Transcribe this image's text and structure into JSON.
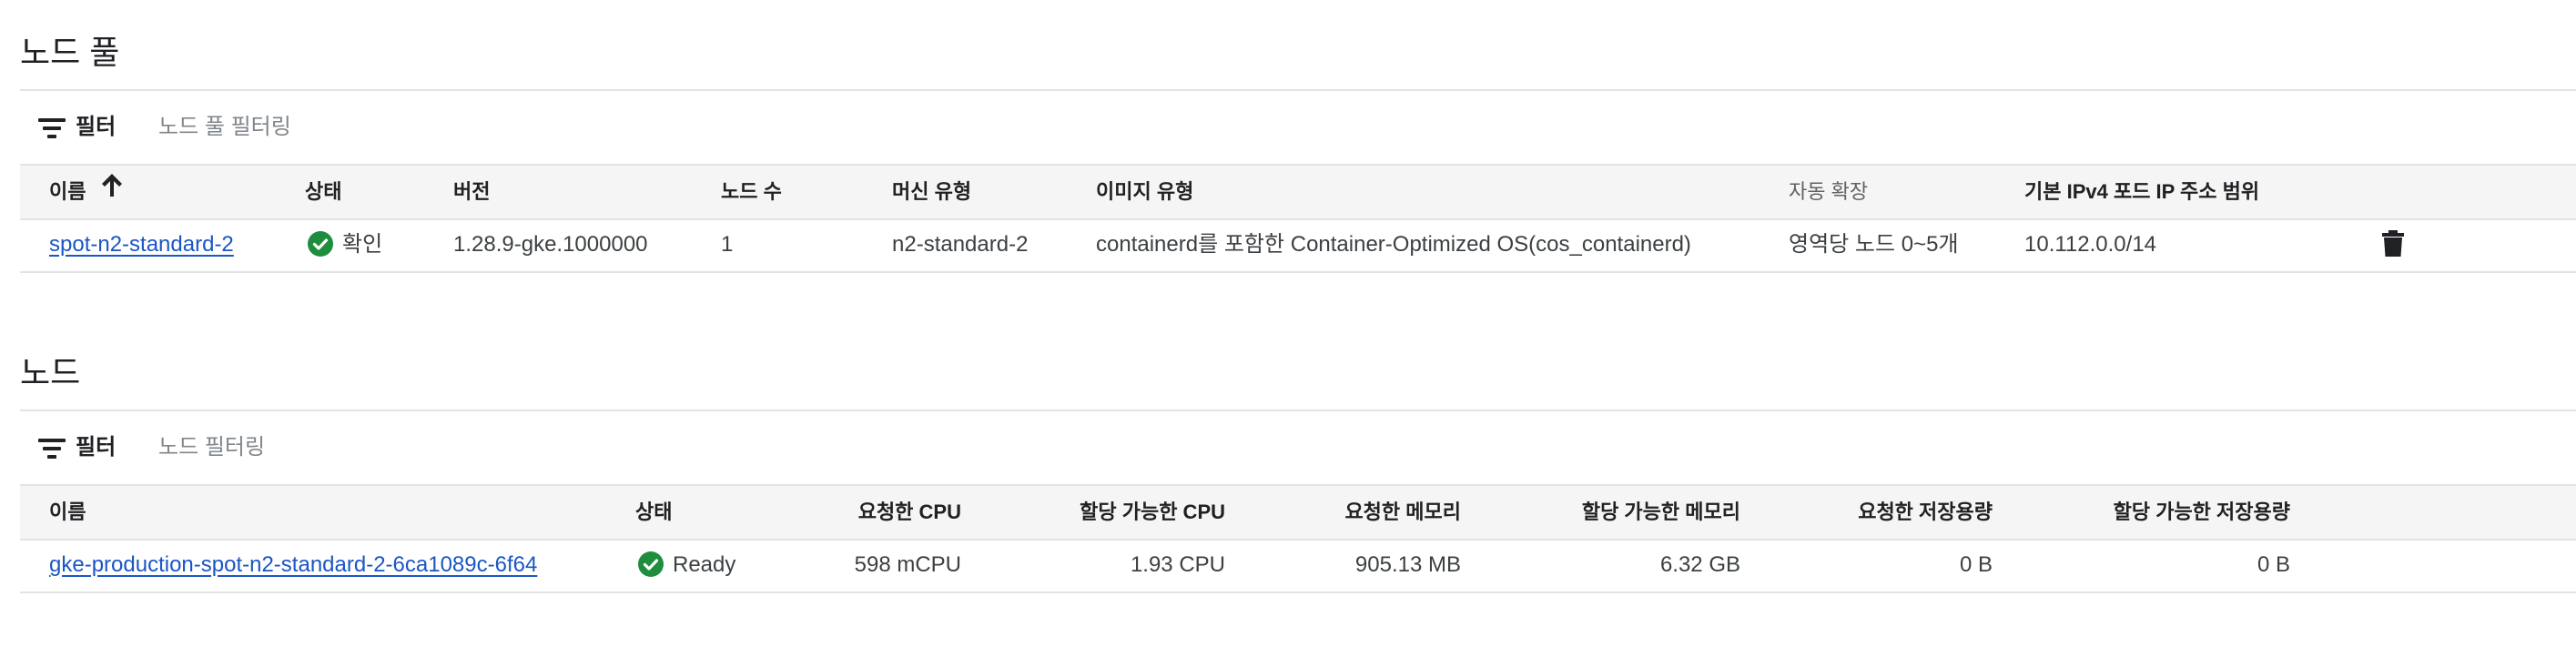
{
  "node_pools": {
    "title": "노드 풀",
    "filter": {
      "label": "필터",
      "placeholder": "노드 풀 필터링"
    },
    "columns": {
      "name": "이름",
      "status": "상태",
      "version": "버전",
      "node_count": "노드 수",
      "machine_type": "머신 유형",
      "image_type": "이미지 유형",
      "autoscaling": "자동 확장",
      "pod_ip_range": "기본 IPv4 포드 IP 주소 범위"
    },
    "rows": [
      {
        "name": "spot-n2-standard-2",
        "status": "확인",
        "version": "1.28.9-gke.1000000",
        "node_count": "1",
        "machine_type": "n2-standard-2",
        "image_type": "containerd를 포함한 Container-Optimized OS(cos_containerd)",
        "autoscaling": "영역당 노드 0~5개",
        "pod_ip_range": "10.112.0.0/14"
      }
    ]
  },
  "nodes": {
    "title": "노드",
    "filter": {
      "label": "필터",
      "placeholder": "노드 필터링"
    },
    "columns": {
      "name": "이름",
      "status": "상태",
      "requested_cpu": "요청한 CPU",
      "allocatable_cpu": "할당 가능한 CPU",
      "requested_memory": "요청한 메모리",
      "allocatable_memory": "할당 가능한 메모리",
      "requested_storage": "요청한 저장용량",
      "allocatable_storage": "할당 가능한 저장용량"
    },
    "rows": [
      {
        "name": "gke-production-spot-n2-standard-2-6ca1089c-6f64",
        "status": "Ready",
        "requested_cpu": "598 mCPU",
        "allocatable_cpu": "1.93 CPU",
        "requested_memory": "905.13 MB",
        "allocatable_memory": "6.32 GB",
        "requested_storage": "0 B",
        "allocatable_storage": "0 B"
      }
    ]
  },
  "icons": {
    "filter": "filter-list-icon",
    "sort": "arrow-upward-icon",
    "status_ok": "check-circle-icon",
    "delete": "trash-icon"
  },
  "colors": {
    "link": "#1a56c4",
    "status_ok": "#1e8e3e",
    "header_bg": "#f5f5f5"
  }
}
